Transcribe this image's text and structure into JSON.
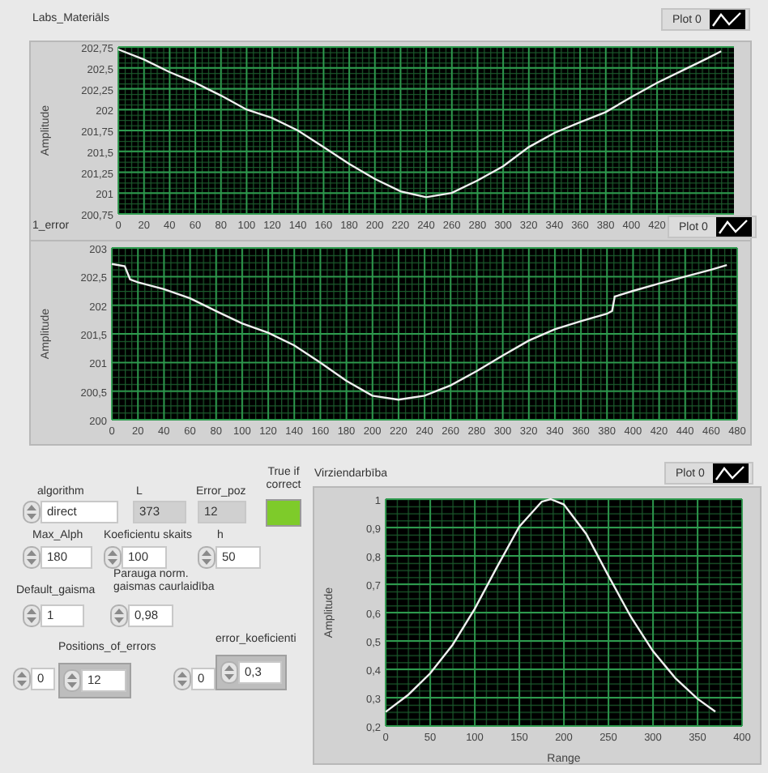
{
  "graphs": [
    {
      "label": "Labs_Materiāls",
      "chart_data": {
        "type": "line",
        "grid": true,
        "ylabel": "Amplitude",
        "xlim": [
          0,
          480
        ],
        "ylim": [
          200.75,
          202.75
        ],
        "xticks": [
          0,
          20,
          40,
          60,
          80,
          100,
          120,
          140,
          160,
          180,
          200,
          220,
          240,
          260,
          280,
          300,
          320,
          340,
          360,
          380,
          400,
          420
        ],
        "yticks": [
          {
            "value": 200.75,
            "label": "200,75"
          },
          {
            "value": 201,
            "label": "201"
          },
          {
            "value": 201.25,
            "label": "201,25"
          },
          {
            "value": 201.5,
            "label": "201,5"
          },
          {
            "value": 201.75,
            "label": "201,75"
          },
          {
            "value": 202,
            "label": "202"
          },
          {
            "value": 202.25,
            "label": "202,25"
          },
          {
            "value": 202.5,
            "label": "202,5"
          },
          {
            "value": 202.75,
            "label": "202,75"
          }
        ],
        "x": [
          0,
          20,
          40,
          60,
          80,
          100,
          120,
          140,
          160,
          180,
          200,
          220,
          240,
          260,
          280,
          300,
          320,
          340,
          360,
          380,
          400,
          420,
          440,
          460,
          470
        ],
        "series": [
          {
            "name": "Plot 0",
            "color": "#f0f0f0",
            "values": [
              202.72,
              202.6,
              202.45,
              202.32,
              202.17,
              202.0,
              201.9,
              201.75,
              201.55,
              201.35,
              201.17,
              201.02,
              200.95,
              201.0,
              201.15,
              201.32,
              201.55,
              201.72,
              201.85,
              201.97,
              202.15,
              202.32,
              202.47,
              202.62,
              202.7
            ]
          }
        ]
      }
    },
    {
      "label": "1_error",
      "chart_data": {
        "type": "line",
        "grid": true,
        "ylabel": "Amplitude",
        "xlim": [
          0,
          480
        ],
        "ylim": [
          200,
          203
        ],
        "xticks": [
          0,
          20,
          40,
          60,
          80,
          100,
          120,
          140,
          160,
          180,
          200,
          220,
          240,
          260,
          280,
          300,
          320,
          340,
          360,
          380,
          400,
          420,
          440,
          460,
          480
        ],
        "yticks": [
          {
            "value": 200,
            "label": "200"
          },
          {
            "value": 200.5,
            "label": "200,5"
          },
          {
            "value": 201,
            "label": "201"
          },
          {
            "value": 201.5,
            "label": "201,5"
          },
          {
            "value": 202,
            "label": "202"
          },
          {
            "value": 202.5,
            "label": "202,5"
          },
          {
            "value": 203,
            "label": "203"
          }
        ],
        "x": [
          0,
          10,
          14,
          20,
          40,
          60,
          80,
          100,
          120,
          140,
          160,
          180,
          200,
          220,
          240,
          260,
          280,
          300,
          320,
          340,
          360,
          380,
          384,
          386,
          400,
          420,
          440,
          460,
          472
        ],
        "series": [
          {
            "name": "Plot 0",
            "color": "#f0f0f0",
            "values": [
              202.72,
              202.68,
              202.45,
              202.4,
              202.28,
              202.12,
              201.9,
              201.68,
              201.52,
              201.3,
              201.0,
              200.68,
              200.42,
              200.35,
              200.42,
              200.6,
              200.85,
              201.12,
              201.38,
              201.58,
              201.72,
              201.85,
              201.9,
              202.15,
              202.25,
              202.38,
              202.5,
              202.62,
              202.7
            ]
          }
        ]
      }
    },
    {
      "label": "Virziendarbība",
      "chart_data": {
        "type": "line",
        "grid": true,
        "xlabel": "Range",
        "ylabel": "Amplitude",
        "xlim": [
          0,
          400
        ],
        "ylim": [
          0.2,
          1
        ],
        "xticks": [
          0,
          50,
          100,
          150,
          200,
          250,
          300,
          350,
          400
        ],
        "yticks": [
          {
            "value": 0.2,
            "label": "0,2"
          },
          {
            "value": 0.3,
            "label": "0,3"
          },
          {
            "value": 0.4,
            "label": "0,4"
          },
          {
            "value": 0.5,
            "label": "0,5"
          },
          {
            "value": 0.6,
            "label": "0,6"
          },
          {
            "value": 0.7,
            "label": "0,7"
          },
          {
            "value": 0.8,
            "label": "0,8"
          },
          {
            "value": 0.9,
            "label": "0,9"
          },
          {
            "value": 1,
            "label": "1"
          }
        ],
        "x": [
          0,
          25,
          50,
          75,
          100,
          125,
          150,
          175,
          185,
          200,
          225,
          250,
          275,
          300,
          325,
          350,
          370
        ],
        "series": [
          {
            "name": "Plot 0",
            "color": "#f0f0f0",
            "values": [
              0.25,
              0.309,
              0.386,
              0.486,
              0.613,
              0.761,
              0.903,
              0.991,
              1,
              0.981,
              0.877,
              0.73,
              0.586,
              0.464,
              0.369,
              0.296,
              0.251
            ]
          }
        ]
      }
    }
  ],
  "controls": [
    {
      "kind": "ring",
      "label": "algorithm",
      "value": "direct"
    },
    {
      "kind": "indicator",
      "label": "L",
      "value": "373"
    },
    {
      "kind": "indicator",
      "label": "Error_poz",
      "value": "12"
    },
    {
      "kind": "led",
      "label": "True if correct",
      "on": true
    },
    {
      "kind": "numeric",
      "label": "Max_Alph",
      "value": "180"
    },
    {
      "kind": "numeric",
      "label": "Koeficientu skaits",
      "value": "100"
    },
    {
      "kind": "numeric",
      "label": "h",
      "value": "50"
    },
    {
      "kind": "numeric",
      "label": "Default_gaisma",
      "value": "1"
    },
    {
      "kind": "numeric",
      "label": "Parauga norm. gaismas caurlaidība",
      "value": "0,98"
    },
    {
      "kind": "array",
      "label": "Positions_of_errors",
      "index": "0",
      "value": "12"
    },
    {
      "kind": "array",
      "label": "error_koeficienti",
      "index": "0",
      "value": "0,3"
    }
  ]
}
